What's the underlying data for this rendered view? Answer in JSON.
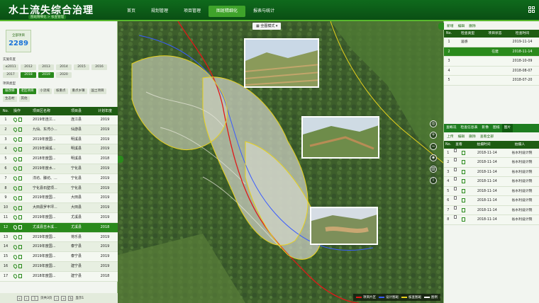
{
  "header": {
    "title": "水土流失综合治理",
    "subtitle": "图斑精细化 > 核查管理",
    "nav": [
      "首页",
      "规划管理",
      "项目管理",
      "图斑精细化",
      "报表与统计"
    ],
    "active_nav": "图斑精细化"
  },
  "left": {
    "total_label": "全部项目",
    "total_value": "2289",
    "year_label": "实施年度",
    "years": [
      "≤2011",
      "2012",
      "2013",
      "2014",
      "2015",
      "2016",
      "2017",
      "2018",
      "2019",
      "2020"
    ],
    "active_years": [
      "2018",
      "2019"
    ],
    "type_label": "项目类型",
    "types": [
      "坡改梯",
      "老区项目",
      "小流域",
      "核重点",
      "重点乡镇",
      "国土项目",
      "生态村",
      "其他"
    ],
    "active_types": [
      "坡改梯",
      "老区项目"
    ],
    "table_headers": [
      "No.",
      "操作",
      "项目区名称",
      "项目县",
      "计划年度"
    ],
    "rows": [
      {
        "no": "1",
        "name": "2019年连江...",
        "county": "连江县",
        "year": "2019"
      },
      {
        "no": "2",
        "name": "九仙、东湾小...",
        "county": "仙游县",
        "year": "2019"
      },
      {
        "no": "3",
        "name": "2019年度国...",
        "county": "明溪县",
        "year": "2019"
      },
      {
        "no": "4",
        "name": "2019年闽溪...",
        "county": "明溪县",
        "year": "2019"
      },
      {
        "no": "5",
        "name": "2018年度国...",
        "county": "明溪县",
        "year": "2018"
      },
      {
        "no": "6",
        "name": "2019年度水...",
        "county": "宁化县",
        "year": "2019"
      },
      {
        "no": "7",
        "name": "洋坊、滕坊、...",
        "county": "宁化县",
        "year": "2019"
      },
      {
        "no": "8",
        "name": "宁化县石壁项...",
        "county": "宁化县",
        "year": "2019"
      },
      {
        "no": "9",
        "name": "2019年度国...",
        "county": "大田县",
        "year": "2019"
      },
      {
        "no": "10",
        "name": "大田县罗丰坪...",
        "county": "大田县",
        "year": "2019"
      },
      {
        "no": "11",
        "name": "2019年度国...",
        "county": "尤溪县",
        "year": "2019"
      },
      {
        "no": "12",
        "name": "尤溪县吉木溪...",
        "county": "尤溪县",
        "year": "2018"
      },
      {
        "no": "13",
        "name": "2019年度国...",
        "county": "将乐县",
        "year": "2019"
      },
      {
        "no": "14",
        "name": "2019年度国...",
        "county": "泰宁县",
        "year": "2019"
      },
      {
        "no": "15",
        "name": "2019年度国...",
        "county": "泰宁县",
        "year": "2019"
      },
      {
        "no": "16",
        "name": "2019年度国...",
        "county": "建宁县",
        "year": "2019"
      },
      {
        "no": "17",
        "name": "2018年度国...",
        "county": "建宁县",
        "year": "2018"
      }
    ],
    "active_row": "12",
    "pager": {
      "page_text": "页共3页",
      "page": "1",
      "per_page": "显示1"
    }
  },
  "map": {
    "view_mode": "全图模式",
    "legend": [
      {
        "label": "项目片区",
        "color": "#e01818"
      },
      {
        "label": "设计图斑",
        "color": "#3a5cff"
      },
      {
        "label": "核查图斑",
        "color": "#e8d21c"
      },
      {
        "label": "图例",
        "color": "#ffffff"
      }
    ],
    "controls": [
      "locate-icon",
      "zoom-in-icon",
      "zoom-out-icon",
      "layers-icon",
      "measure-icon",
      "info-icon"
    ]
  },
  "right": {
    "toolbar1": [
      "新增",
      "编辑",
      "删除"
    ],
    "table1_headers": [
      "No.",
      "检查类型",
      "项目状态",
      "检查时间"
    ],
    "table1_rows": [
      {
        "no": "1",
        "type": "遥感",
        "status": "",
        "date": "2019-11-14"
      },
      {
        "no": "2",
        "type": "",
        "status": "在建",
        "date": "2018-11-14"
      },
      {
        "no": "3",
        "type": "",
        "status": "",
        "date": "2018-10-09"
      },
      {
        "no": "4",
        "type": "",
        "status": "",
        "date": "2018-08-07"
      },
      {
        "no": "5",
        "type": "",
        "status": "",
        "date": "2018-07-20"
      }
    ],
    "table1_active": "2",
    "tabs": [
      "查概况",
      "检查信息表",
      "影像",
      "图纸",
      "图片"
    ],
    "active_tab": "图片",
    "toolbar2": [
      "上传",
      "编辑",
      "删除",
      "查看全部"
    ],
    "table2_headers": [
      "No.",
      "查看",
      "拍摄时间",
      "拍摄人"
    ],
    "table2_rows": [
      {
        "no": "1",
        "date": "2018-11-14",
        "by": "省水利设计院"
      },
      {
        "no": "2",
        "date": "2018-11-14",
        "by": "省水利设计院"
      },
      {
        "no": "3",
        "date": "2018-11-14",
        "by": "省水利设计院"
      },
      {
        "no": "4",
        "date": "2018-11-14",
        "by": "省水利设计院"
      },
      {
        "no": "5",
        "date": "2018-11-14",
        "by": "省水利设计院"
      },
      {
        "no": "6",
        "date": "2018-11-14",
        "by": "省水利设计院"
      },
      {
        "no": "7",
        "date": "2018-11-14",
        "by": "省水利设计院"
      },
      {
        "no": "8",
        "date": "2018-11-14",
        "by": "省水利设计院"
      }
    ]
  }
}
